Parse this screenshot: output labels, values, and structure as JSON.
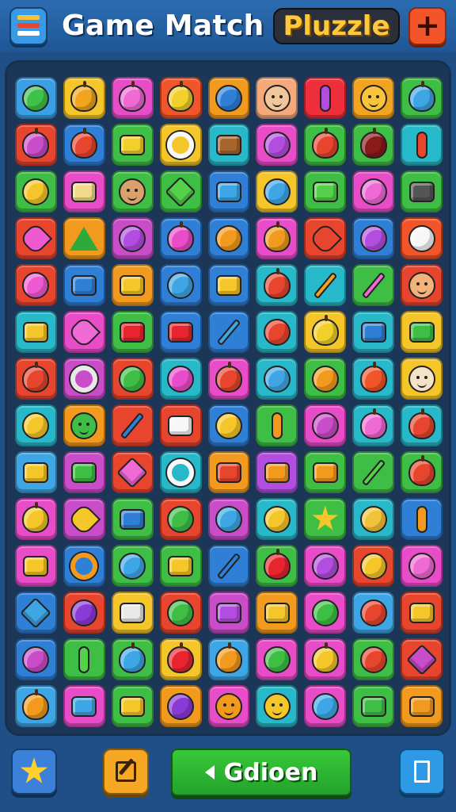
{
  "header": {
    "title": "Game Match",
    "badge": "Pluzzle",
    "menu_icon": "menu-icon",
    "add_icon": "plus-icon",
    "add_symbol": "+"
  },
  "board": {
    "columns": 9,
    "rows": [
      [
        [
          "#3aa0e6",
          "ball",
          "#3fc24a"
        ],
        [
          "#f5c62a",
          "fruit",
          "#f0a51c"
        ],
        [
          "#e94cc9",
          "fruit",
          "#f06ad6"
        ],
        [
          "#f2552a",
          "fruit",
          "#f2d02a"
        ],
        [
          "#f29a1e",
          "ball",
          "#2f7fd6"
        ],
        [
          "#f5a97a",
          "face",
          "#f0c69a"
        ],
        [
          "#ee2f3b",
          "capsule",
          "#b24de0"
        ],
        [
          "#f2a31f",
          "face",
          "#f7c43a"
        ],
        [
          "#3fbe45",
          "fruit",
          "#3fa6e6"
        ]
      ],
      [
        [
          "#e8452f",
          "fruit",
          "#c94cc8"
        ],
        [
          "#2f7fd6",
          "fruit",
          "#e8452f"
        ],
        [
          "#3fbe45",
          "box",
          "#f2d02a"
        ],
        [
          "#f5c62a",
          "ring",
          "#f7f7f7"
        ],
        [
          "#27b8c9",
          "box",
          "#a8642a"
        ],
        [
          "#e94cc9",
          "ball",
          "#b24de0"
        ],
        [
          "#3fbe45",
          "fruit",
          "#e8452f"
        ],
        [
          "#3fbe45",
          "fruit",
          "#8a1a1a"
        ],
        [
          "#27b8c9",
          "capsule",
          "#e8452f"
        ]
      ],
      [
        [
          "#3fbe45",
          "ball",
          "#f5c62a"
        ],
        [
          "#e94cc9",
          "box",
          "#f2d98a"
        ],
        [
          "#3fbe45",
          "face",
          "#d9a26a"
        ],
        [
          "#3fbe45",
          "gem",
          "#54d04a"
        ],
        [
          "#2f7fd6",
          "box",
          "#3fa6e6"
        ],
        [
          "#f5c62a",
          "ball",
          "#3fa6e6"
        ],
        [
          "#3fbe45",
          "box",
          "#54d04a"
        ],
        [
          "#e94cc9",
          "ball",
          "#f06ad6"
        ],
        [
          "#3fbe45",
          "box",
          "#555555"
        ]
      ],
      [
        [
          "#e8452f",
          "heart",
          "#f05ad0"
        ],
        [
          "#f29a1e",
          "tri",
          "#2faa3a"
        ],
        [
          "#c94cc8",
          "ball",
          "#b24de0"
        ],
        [
          "#2f7fd6",
          "fruit",
          "#e94cc9"
        ],
        [
          "#2f7fd6",
          "ball",
          "#f29a1e"
        ],
        [
          "#e94cc9",
          "fruit",
          "#f29a1e"
        ],
        [
          "#e8452f",
          "heart",
          "#e8452f"
        ],
        [
          "#2f7fd6",
          "ball",
          "#b24de0"
        ],
        [
          "#f2552a",
          "ball",
          "#f7f7f7"
        ]
      ],
      [
        [
          "#e8452f",
          "ball",
          "#f05ad0"
        ],
        [
          "#2f7fd6",
          "box",
          "#2f7fd6"
        ],
        [
          "#f29a1e",
          "box",
          "#f5c62a"
        ],
        [
          "#2f7fd6",
          "ball",
          "#3fa6e6"
        ],
        [
          "#2f7fd6",
          "box",
          "#f5c62a"
        ],
        [
          "#27b8c9",
          "fruit",
          "#e8452f"
        ],
        [
          "#27b8c9",
          "pencil",
          "#f2a31f"
        ],
        [
          "#3fbe45",
          "pencil",
          "#f06ad6"
        ],
        [
          "#e8452f",
          "face",
          "#f2b37a"
        ]
      ],
      [
        [
          "#27b8c9",
          "box",
          "#f5c62a"
        ],
        [
          "#e94cc9",
          "heart",
          "#f06ad6"
        ],
        [
          "#3fbe45",
          "box",
          "#e8252f"
        ],
        [
          "#2f7fd6",
          "box",
          "#e8252f"
        ],
        [
          "#2f7fd6",
          "pencil",
          "#3fa6e6"
        ],
        [
          "#27b8c9",
          "ball",
          "#e8452f"
        ],
        [
          "#f5c62a",
          "fruit",
          "#f2d02a"
        ],
        [
          "#27b8c9",
          "box",
          "#2f7fd6"
        ],
        [
          "#f5c62a",
          "box",
          "#3fbe45"
        ]
      ],
      [
        [
          "#e8452f",
          "fruit",
          "#e8452f"
        ],
        [
          "#c94cc8",
          "ring",
          "#e8e8e8"
        ],
        [
          "#e8452f",
          "ball",
          "#3fbe45"
        ],
        [
          "#27b8c9",
          "ball",
          "#e94cc9"
        ],
        [
          "#e94cc9",
          "fruit",
          "#e8452f"
        ],
        [
          "#27b8c9",
          "ball",
          "#3fa6e6"
        ],
        [
          "#3fbe45",
          "ball",
          "#f29a1e"
        ],
        [
          "#27b8c9",
          "fruit",
          "#f2552a"
        ],
        [
          "#f5c62a",
          "face",
          "#f5e3c9"
        ]
      ],
      [
        [
          "#27b8c9",
          "ball",
          "#f5c62a"
        ],
        [
          "#f29a1e",
          "face",
          "#3fbe45"
        ],
        [
          "#e8452f",
          "pencil",
          "#2f7fd6"
        ],
        [
          "#e8452f",
          "box",
          "#f7f7f7"
        ],
        [
          "#2f7fd6",
          "ball",
          "#f5c62a"
        ],
        [
          "#3fbe45",
          "capsule",
          "#f29a1e"
        ],
        [
          "#e94cc9",
          "ball",
          "#c94cc8"
        ],
        [
          "#27b8c9",
          "fruit",
          "#f06ad6"
        ],
        [
          "#27b8c9",
          "fruit",
          "#e8452f"
        ]
      ],
      [
        [
          "#3fa6e6",
          "box",
          "#f5c62a"
        ],
        [
          "#c94cc8",
          "box",
          "#3fbe45"
        ],
        [
          "#e8452f",
          "gem",
          "#f06ad6"
        ],
        [
          "#27b8c9",
          "ring",
          "#f7f7f7"
        ],
        [
          "#f29a1e",
          "box",
          "#e8452f"
        ],
        [
          "#b24de0",
          "box",
          "#f29a1e"
        ],
        [
          "#3fbe45",
          "box",
          "#f29a1e"
        ],
        [
          "#3fbe45",
          "pencil",
          "#54d04a"
        ],
        [
          "#3fbe45",
          "fruit",
          "#e8452f"
        ]
      ],
      [
        [
          "#e94cc9",
          "fruit",
          "#f5c62a"
        ],
        [
          "#c94cc8",
          "heart",
          "#f5c62a"
        ],
        [
          "#3fbe45",
          "box",
          "#2f7fd6"
        ],
        [
          "#e8452f",
          "ball",
          "#3fbe45"
        ],
        [
          "#c94cc8",
          "ball",
          "#3fa6e6"
        ],
        [
          "#27b8c9",
          "ball",
          "#f5c62a"
        ],
        [
          "#3fbe45",
          "star",
          "#f5c62a"
        ],
        [
          "#27b8c9",
          "ball",
          "#f2c23a"
        ],
        [
          "#2f7fd6",
          "capsule",
          "#f29a1e"
        ]
      ],
      [
        [
          "#e94cc9",
          "box",
          "#f5c62a"
        ],
        [
          "#2f7fd6",
          "ring",
          "#f29a1e"
        ],
        [
          "#3fbe45",
          "ball",
          "#3fa6e6"
        ],
        [
          "#3fbe45",
          "box",
          "#f5c62a"
        ],
        [
          "#2f7fd6",
          "pencil",
          "#2f7fd6"
        ],
        [
          "#3fbe45",
          "fruit",
          "#e8252f"
        ],
        [
          "#e94cc9",
          "ball",
          "#b24de0"
        ],
        [
          "#e8452f",
          "ball",
          "#f5c62a"
        ],
        [
          "#e94cc9",
          "ball",
          "#f06ad6"
        ]
      ],
      [
        [
          "#2f7fd6",
          "gem",
          "#3fa6e6"
        ],
        [
          "#e8452f",
          "ball",
          "#8a3ad6"
        ],
        [
          "#f5c62a",
          "box",
          "#e8e8e8"
        ],
        [
          "#e8452f",
          "ball",
          "#3fbe45"
        ],
        [
          "#c94cc8",
          "box",
          "#b24de0"
        ],
        [
          "#f29a1e",
          "box",
          "#f5c62a"
        ],
        [
          "#e94cc9",
          "ball",
          "#3fbe45"
        ],
        [
          "#3fa6e6",
          "ball",
          "#e8452f"
        ],
        [
          "#e8452f",
          "box",
          "#f5c62a"
        ]
      ],
      [
        [
          "#2f7fd6",
          "ball",
          "#c94cc8"
        ],
        [
          "#3fbe45",
          "capsule",
          "#54d04a"
        ],
        [
          "#3fbe45",
          "fruit",
          "#3fa6e6"
        ],
        [
          "#f5c62a",
          "fruit",
          "#e8252f"
        ],
        [
          "#3fa6e6",
          "fruit",
          "#f29a1e"
        ],
        [
          "#e94cc9",
          "ball",
          "#3fbe45"
        ],
        [
          "#e94cc9",
          "fruit",
          "#f5c62a"
        ],
        [
          "#3fbe45",
          "ball",
          "#e8452f"
        ],
        [
          "#e8452f",
          "gem",
          "#c94cc8"
        ]
      ],
      [
        [
          "#3fa6e6",
          "fruit",
          "#f29a1e"
        ],
        [
          "#e94cc9",
          "box",
          "#3fa6e6"
        ],
        [
          "#3fbe45",
          "box",
          "#f5c62a"
        ],
        [
          "#f29a1e",
          "ball",
          "#8a3ad6"
        ],
        [
          "#e94cc9",
          "face",
          "#f29a1e"
        ],
        [
          "#27b8c9",
          "face",
          "#f5c62a"
        ],
        [
          "#e94cc9",
          "ball",
          "#3fa6e6"
        ],
        [
          "#3fbe45",
          "box",
          "#3fbe45"
        ],
        [
          "#f29a1e",
          "box",
          "#f29a1e"
        ]
      ]
    ]
  },
  "footer": {
    "star_icon": "star-icon",
    "edit_icon": "edit-icon",
    "go_label": "Gdioen",
    "go_icon": "arrow-left-icon",
    "frame_icon": "frame-icon"
  },
  "colors": {
    "background": "#1f4f86",
    "board": "#1c3658",
    "accent_yellow": "#ffc93a",
    "go_green": "#2fb533"
  }
}
